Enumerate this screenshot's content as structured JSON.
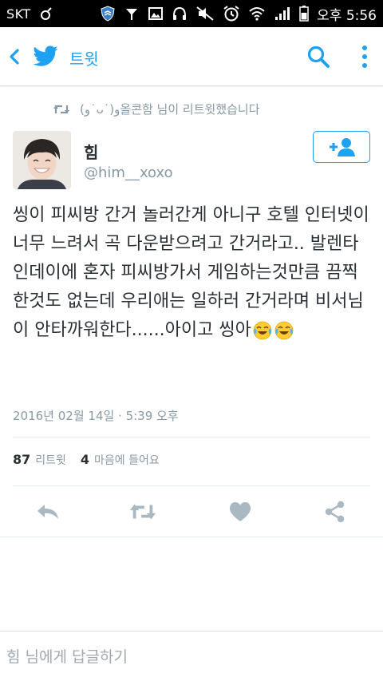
{
  "status_bar": {
    "carrier": "SKT",
    "time": "오후 5:56"
  },
  "appbar": {
    "title": "트윗"
  },
  "retweet_notice": {
    "text": "(ﻭ˙ᴗ˙)ﻭ올콘함 님이 리트윗했습니다"
  },
  "tweet": {
    "author_name": "힘",
    "author_handle": "@him__xoxo",
    "text": "씽이 피씨방 간거 놀러간게 아니구 호텔 인터넷이 너무 느려서 곡 다운받으려고 간거라고.. 발렌타인데이에 혼자 피씨방가서 게임하는것만큼 끔찍한것도 없는데 우리애는 일하러 간거라며 비서님이 안타까워한다......아이고 씽아",
    "emojis": [
      "crying-laughing-face",
      "crying-laughing-face"
    ],
    "timestamp": "2016년 02월 14일 · 5:39 오후",
    "retweet_count": "87",
    "retweet_label": "리트윗",
    "like_count": "4",
    "like_label": "마음에 들어요"
  },
  "reply": {
    "placeholder": "힘 님에게 답글하기"
  },
  "colors": {
    "accent": "#1da1f2",
    "muted": "#8899a6",
    "icon": "#aab8c2",
    "text": "#292f33"
  }
}
